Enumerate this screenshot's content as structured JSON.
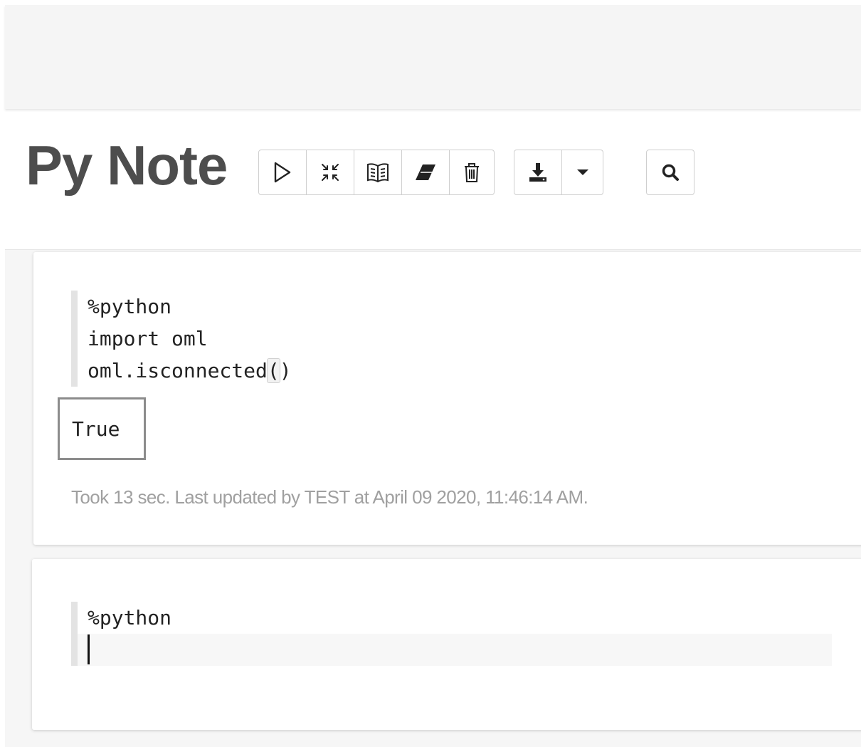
{
  "header": {
    "title": "Py Note"
  },
  "toolbar": {
    "group1": [
      {
        "name": "run-all-button",
        "icon": "play-icon"
      },
      {
        "name": "toggle-code-button",
        "icon": "compress-arrows-icon"
      },
      {
        "name": "show-output-button",
        "icon": "book-icon"
      },
      {
        "name": "clear-output-button",
        "icon": "eraser-icon"
      },
      {
        "name": "delete-button",
        "icon": "trash-icon"
      }
    ],
    "group2": [
      {
        "name": "export-button",
        "icon": "download-icon"
      },
      {
        "name": "export-dropdown-button",
        "icon": "caret-down-icon"
      }
    ],
    "group3": [
      {
        "name": "search-button",
        "icon": "search-icon"
      }
    ]
  },
  "paragraphs": [
    {
      "lines": [
        "%python",
        "import oml",
        "oml.isconnected",
        "(",
        ")"
      ],
      "output": "True",
      "status": "Took 13 sec. Last updated by TEST at April 09 2020, 11:46:14 AM."
    },
    {
      "lines": [
        "%python"
      ]
    }
  ],
  "colors": {
    "title": "#4d4d4d",
    "status": "#a0a0a0",
    "output_border": "#8c8c8c"
  }
}
